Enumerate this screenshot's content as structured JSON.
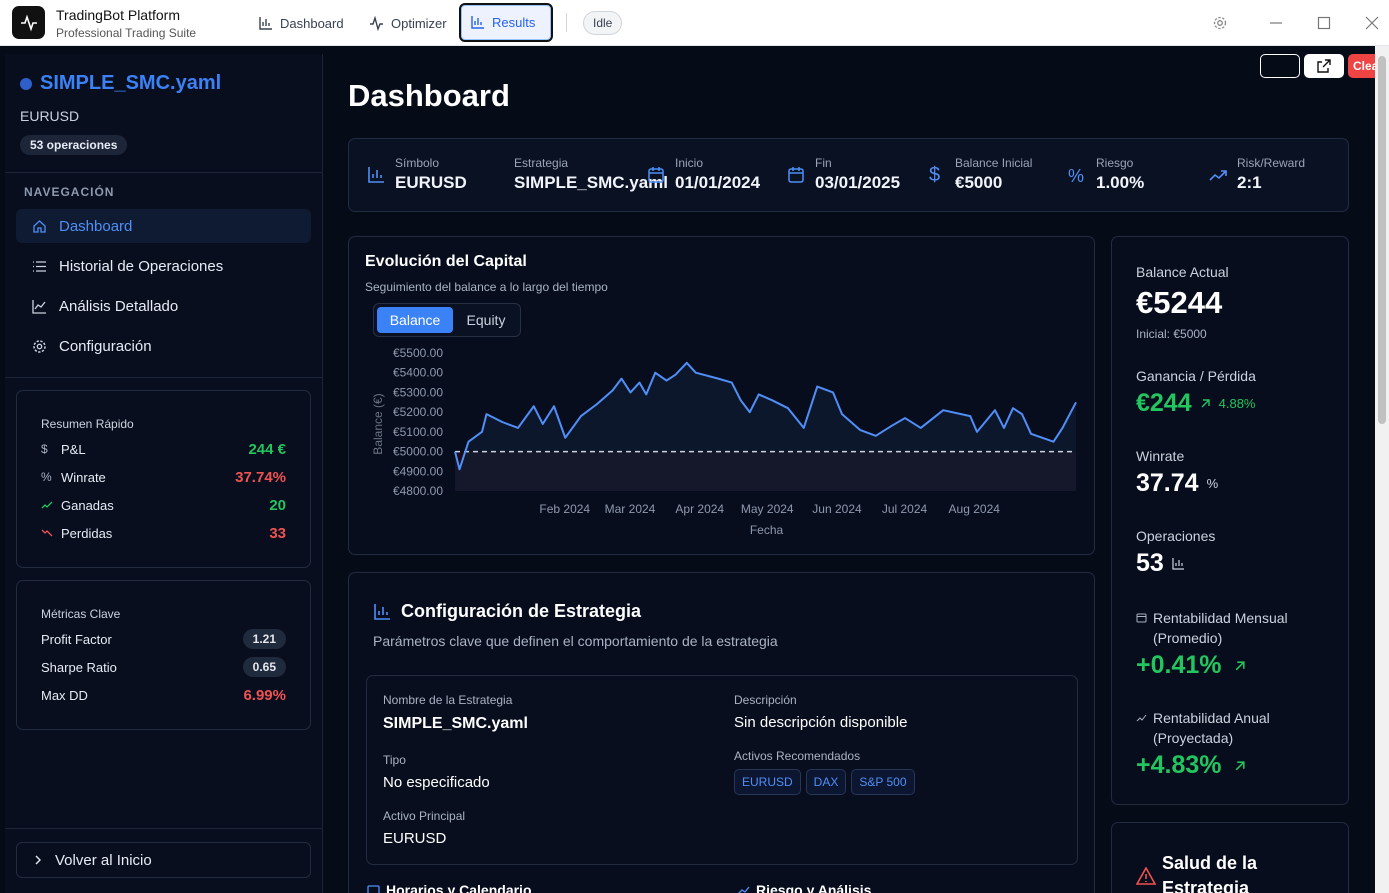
{
  "app": {
    "title": "TradingBot Platform",
    "subtitle": "Professional Trading Suite",
    "status": "Idle"
  },
  "tabs": [
    {
      "label": "Dashboard"
    },
    {
      "label": "Optimizer"
    },
    {
      "label": "Results",
      "active": true
    }
  ],
  "toolbar": {
    "clear_label": "Clear"
  },
  "sidebar": {
    "strategy_name": "SIMPLE_SMC.yaml",
    "symbol": "EURUSD",
    "operations_badge": "53 operaciones",
    "nav_heading": "NAVEGACIÓN",
    "nav": [
      {
        "label": "Dashboard",
        "icon": "home-icon",
        "active": true
      },
      {
        "label": "Historial de Operaciones",
        "icon": "list-icon"
      },
      {
        "label": "Análisis Detallado",
        "icon": "chart-line-icon"
      },
      {
        "label": "Configuración",
        "icon": "gear-icon"
      }
    ],
    "quick_summary": {
      "title": "Resumen Rápido",
      "rows": [
        {
          "icon": "$",
          "label": "P&L",
          "value": "244 €",
          "color": "#22c55e"
        },
        {
          "icon": "%",
          "label": "Winrate",
          "value": "37.74%",
          "color": "#f05252"
        },
        {
          "icon": "trend-up-icon",
          "label": "Ganadas",
          "value": "20",
          "color": "#22c55e"
        },
        {
          "icon": "trend-down-icon",
          "label": "Perdidas",
          "value": "33",
          "color": "#f05252"
        }
      ]
    },
    "key_metrics": {
      "title": "Métricas Clave",
      "rows": [
        {
          "label": "Profit Factor",
          "value": "1.21"
        },
        {
          "label": "Sharpe Ratio",
          "value": "0.65"
        },
        {
          "label": "Max DD",
          "value": "6.99%"
        }
      ]
    },
    "back_label": "Volver al Inicio"
  },
  "main": {
    "title": "Dashboard",
    "stats": [
      {
        "label": "Símbolo",
        "value": "EURUSD",
        "icon": "bar-chart-icon"
      },
      {
        "label": "Estrategia",
        "value": "SIMPLE_SMC.yaml",
        "icon": ""
      },
      {
        "label": "Inicio",
        "value": "01/01/2024",
        "icon": "calendar-icon"
      },
      {
        "label": "Fin",
        "value": "03/01/2025",
        "icon": "calendar-icon"
      },
      {
        "label": "Balance Inicial",
        "value": "€5000",
        "icon": "dollar-icon"
      },
      {
        "label": "Riesgo",
        "value": "1.00%",
        "icon": "percent-icon"
      },
      {
        "label": "Risk/Reward",
        "value": "2:1",
        "icon": "trend-up-icon"
      }
    ],
    "capital": {
      "title": "Evolución del Capital",
      "subtitle": "Seguimiento del balance a lo largo del tiempo",
      "toggle": [
        "Balance",
        "Equity"
      ]
    },
    "config": {
      "title": "Configuración de Estrategia",
      "subtitle": "Parámetros clave que definen el comportamiento de la estrategia",
      "name_label": "Nombre de la Estrategia",
      "name_value": "SIMPLE_SMC.yaml",
      "type_label": "Tipo",
      "type_value": "No especificado",
      "asset_label": "Activo Principal",
      "asset_value": "EURUSD",
      "desc_label": "Descripción",
      "desc_value": "Sin descripción disponible",
      "rec_label": "Activos Recomendados",
      "rec_assets": [
        "EURUSD",
        "DAX",
        "S&P 500"
      ],
      "footer_left": "Horarios y Calendario",
      "footer_right": "Riesgo y Análisis"
    },
    "right": {
      "balance_label": "Balance Actual",
      "balance_value": "€5244",
      "balance_initial": "Inicial: €5000",
      "pnl_label": "Ganancia / Pérdida",
      "pnl_value": "€244",
      "pnl_pct": "4.88%",
      "winrate_label": "Winrate",
      "winrate_value": "37.74",
      "winrate_unit": "%",
      "ops_label": "Operaciones",
      "ops_value": "53",
      "monthly_label1": "Rentabilidad Mensual",
      "monthly_label2": "(Promedio)",
      "monthly_value": "+0.41%",
      "annual_label1": "Rentabilidad Anual",
      "annual_label2": "(Proyectada)",
      "annual_value": "+4.83%",
      "health_label1": "Salud de la",
      "health_label2": "Estrategia"
    }
  },
  "chart_data": {
    "type": "line",
    "title": "Evolución del Capital",
    "xlabel": "Fecha",
    "ylabel": "Balance (€)",
    "ylim": [
      4800,
      5500
    ],
    "yticks": [
      "€5500.00",
      "€5400.00",
      "€5300.00",
      "€5200.00",
      "€5100.00",
      "€5000.00",
      "€4900.00",
      "€4800.00"
    ],
    "xticks": [
      "Feb 2024",
      "Mar 2024",
      "Apr 2024",
      "May 2024",
      "Jun 2024",
      "Jul 2024",
      "Aug 2024"
    ],
    "baseline": 5000,
    "series": [
      {
        "name": "Balance",
        "color": "#4f8ff7",
        "points": [
          [
            "2024-01-01",
            5000
          ],
          [
            "2024-01-03",
            4910
          ],
          [
            "2024-01-07",
            5050
          ],
          [
            "2024-01-13",
            5100
          ],
          [
            "2024-01-15",
            5190
          ],
          [
            "2024-01-22",
            5150
          ],
          [
            "2024-01-29",
            5120
          ],
          [
            "2024-02-05",
            5230
          ],
          [
            "2024-02-09",
            5140
          ],
          [
            "2024-02-14",
            5230
          ],
          [
            "2024-02-19",
            5070
          ],
          [
            "2024-02-26",
            5180
          ],
          [
            "2024-03-04",
            5240
          ],
          [
            "2024-03-11",
            5310
          ],
          [
            "2024-03-15",
            5370
          ],
          [
            "2024-03-19",
            5300
          ],
          [
            "2024-03-23",
            5350
          ],
          [
            "2024-03-26",
            5290
          ],
          [
            "2024-03-30",
            5400
          ],
          [
            "2024-04-04",
            5360
          ],
          [
            "2024-04-08",
            5390
          ],
          [
            "2024-04-13",
            5450
          ],
          [
            "2024-04-17",
            5400
          ],
          [
            "2024-04-27",
            5370
          ],
          [
            "2024-05-03",
            5350
          ],
          [
            "2024-05-07",
            5260
          ],
          [
            "2024-05-11",
            5200
          ],
          [
            "2024-05-15",
            5290
          ],
          [
            "2024-05-21",
            5260
          ],
          [
            "2024-05-28",
            5220
          ],
          [
            "2024-06-04",
            5120
          ],
          [
            "2024-06-10",
            5330
          ],
          [
            "2024-06-17",
            5300
          ],
          [
            "2024-06-21",
            5190
          ],
          [
            "2024-06-29",
            5110
          ],
          [
            "2024-07-06",
            5080
          ],
          [
            "2024-07-13",
            5130
          ],
          [
            "2024-07-19",
            5170
          ],
          [
            "2024-07-26",
            5120
          ],
          [
            "2024-08-05",
            5210
          ],
          [
            "2024-08-17",
            5180
          ],
          [
            "2024-08-20",
            5100
          ],
          [
            "2024-08-28",
            5210
          ],
          [
            "2024-09-01",
            5120
          ],
          [
            "2024-09-05",
            5220
          ],
          [
            "2024-09-09",
            5190
          ],
          [
            "2024-09-13",
            5090
          ],
          [
            "2024-09-23",
            5050
          ],
          [
            "2024-09-27",
            5120
          ],
          [
            "2024-10-03",
            5250
          ]
        ]
      }
    ]
  }
}
